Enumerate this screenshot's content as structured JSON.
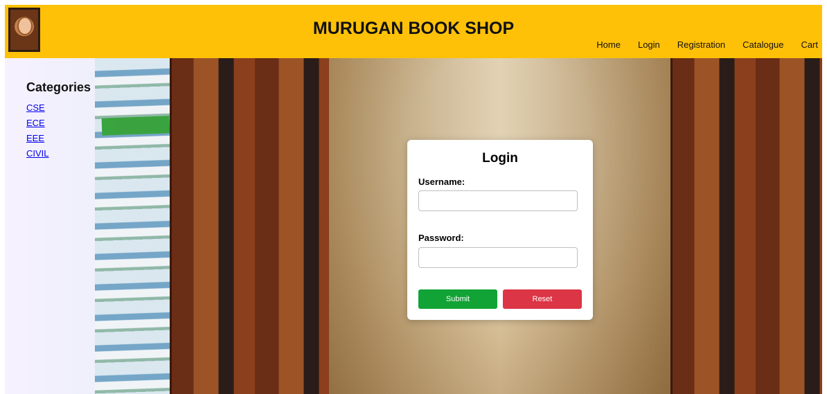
{
  "header": {
    "title": "MURUGAN BOOK SHOP",
    "logo_icon": "portrait-icon",
    "nav": [
      {
        "label": "Home"
      },
      {
        "label": "Login"
      },
      {
        "label": "Registration"
      },
      {
        "label": "Catalogue"
      },
      {
        "label": "Cart"
      }
    ],
    "accent_color": "#ffc107"
  },
  "sidebar": {
    "title": "Categories",
    "links": [
      {
        "label": "CSE"
      },
      {
        "label": "ECE"
      },
      {
        "label": "EEE"
      },
      {
        "label": "CIVIL"
      }
    ]
  },
  "login": {
    "title": "Login",
    "username_label": "Username:",
    "username_value": "",
    "password_label": "Password:",
    "password_value": "",
    "submit_label": "Submit",
    "reset_label": "Reset",
    "submit_color": "#11a335",
    "reset_color": "#dc3545"
  }
}
